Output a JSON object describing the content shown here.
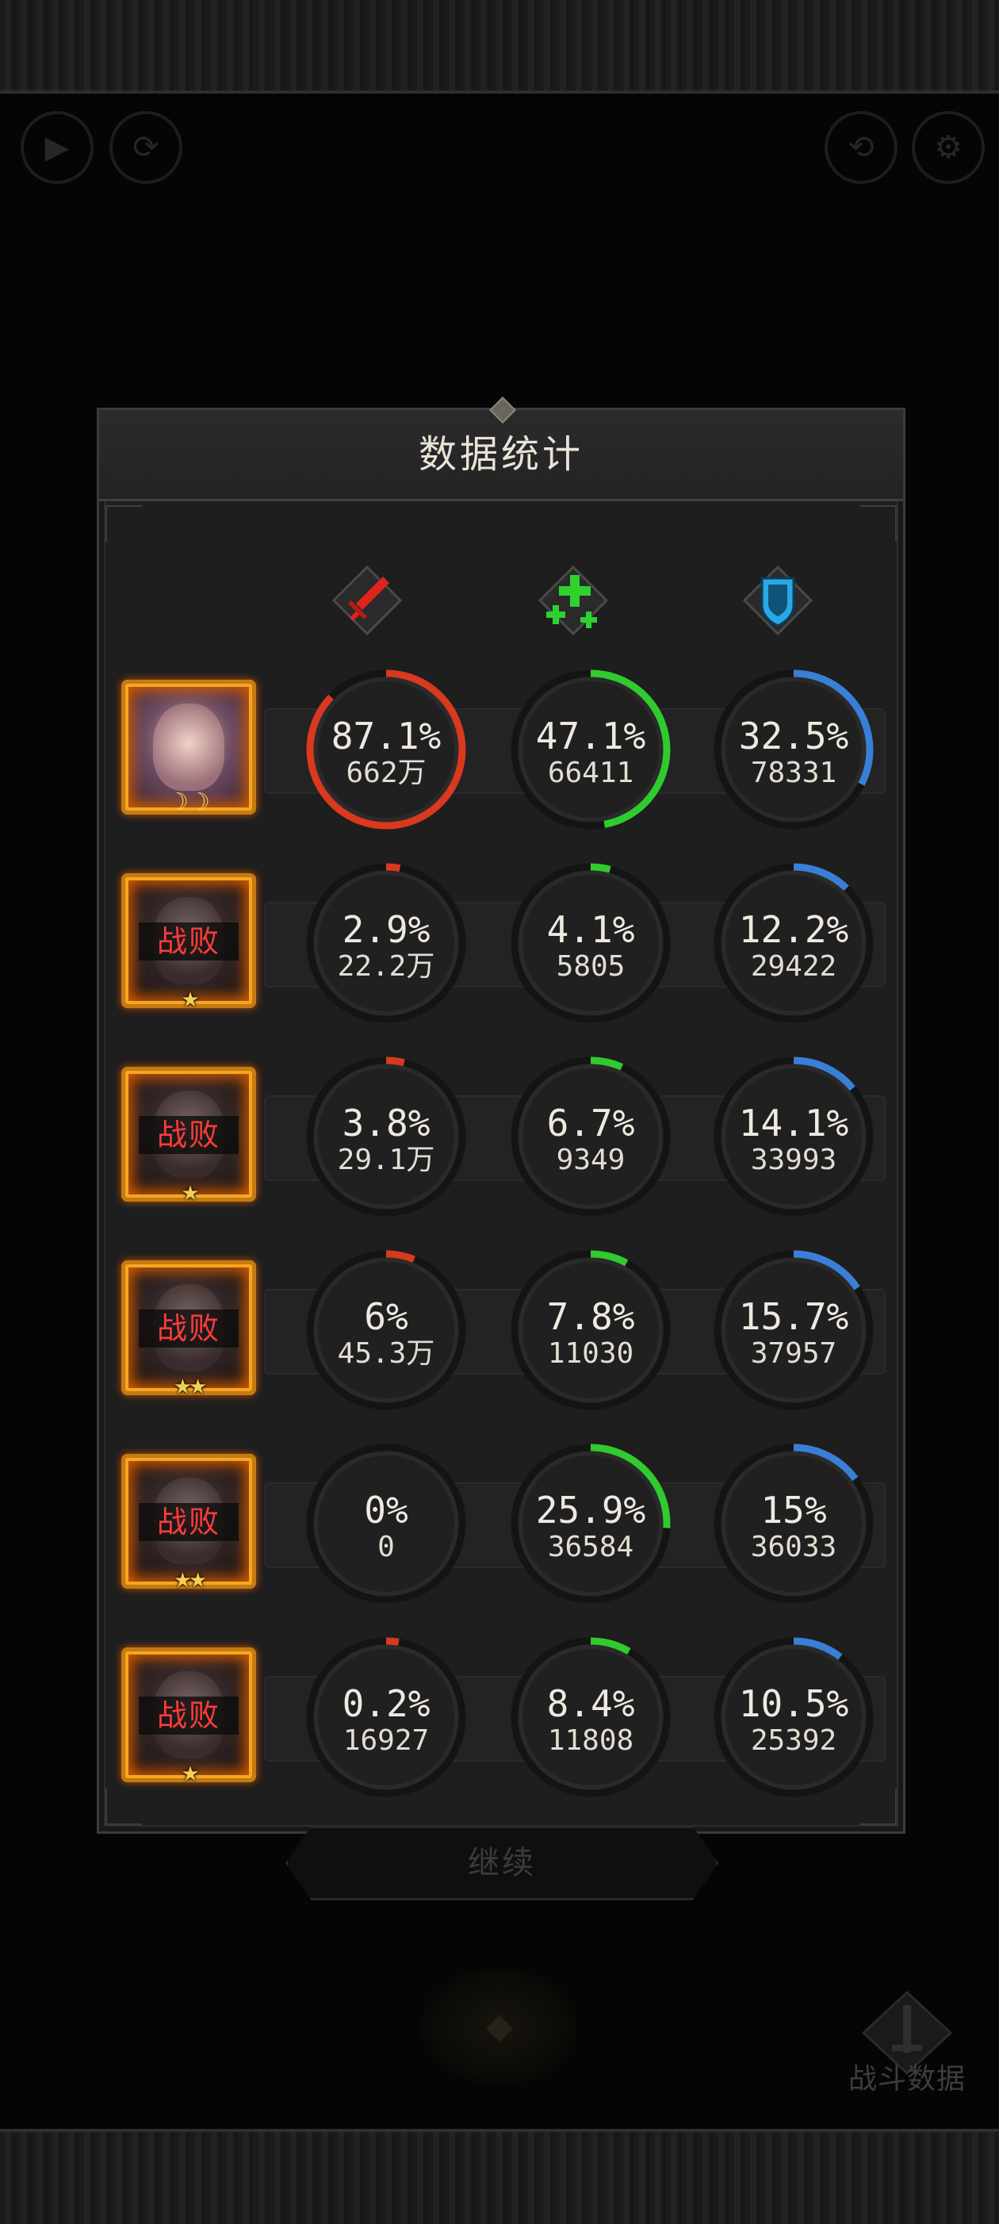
{
  "panel": {
    "title": "数据统计"
  },
  "columns": [
    {
      "icon": "sword-icon",
      "color": "#e0241b"
    },
    {
      "icon": "heal-plus-icon",
      "color": "#2fd12f"
    },
    {
      "icon": "shield-icon",
      "color": "#2aa7e6"
    }
  ],
  "ring_colors": {
    "damage": "#d9391f",
    "heal": "#2fcb2f",
    "tank": "#3a7fd6",
    "track": "#141414"
  },
  "heroes": [
    {
      "status": "",
      "stars": "",
      "rank_icon": "moon-rank-icon",
      "damage": {
        "pct": "87.1%",
        "amount": "662万",
        "fraction": 0.871
      },
      "heal": {
        "pct": "47.1%",
        "amount": "66411",
        "fraction": 0.471
      },
      "tank": {
        "pct": "32.5%",
        "amount": "78331",
        "fraction": 0.325
      }
    },
    {
      "status": "战败",
      "stars": "★",
      "damage": {
        "pct": "2.9%",
        "amount": "22.2万",
        "fraction": 0.029
      },
      "heal": {
        "pct": "4.1%",
        "amount": "5805",
        "fraction": 0.041
      },
      "tank": {
        "pct": "12.2%",
        "amount": "29422",
        "fraction": 0.122
      }
    },
    {
      "status": "战败",
      "stars": "★",
      "damage": {
        "pct": "3.8%",
        "amount": "29.1万",
        "fraction": 0.038
      },
      "heal": {
        "pct": "6.7%",
        "amount": "9349",
        "fraction": 0.067
      },
      "tank": {
        "pct": "14.1%",
        "amount": "33993",
        "fraction": 0.141
      }
    },
    {
      "status": "战败",
      "stars": "★★",
      "damage": {
        "pct": "6%",
        "amount": "45.3万",
        "fraction": 0.06
      },
      "heal": {
        "pct": "7.8%",
        "amount": "11030",
        "fraction": 0.078
      },
      "tank": {
        "pct": "15.7%",
        "amount": "37957",
        "fraction": 0.157
      }
    },
    {
      "status": "战败",
      "stars": "★★",
      "damage": {
        "pct": "0%",
        "amount": "0",
        "fraction": 0
      },
      "heal": {
        "pct": "25.9%",
        "amount": "36584",
        "fraction": 0.259
      },
      "tank": {
        "pct": "15%",
        "amount": "36033",
        "fraction": 0.15
      }
    },
    {
      "status": "战败",
      "stars": "★",
      "damage": {
        "pct": "0.2%",
        "amount": "16927",
        "fraction": 0.002
      },
      "heal": {
        "pct": "8.4%",
        "amount": "11808",
        "fraction": 0.084
      },
      "tank": {
        "pct": "10.5%",
        "amount": "25392",
        "fraction": 0.105
      }
    }
  ],
  "continue_label": "继续",
  "battle_data_label": "战斗数据"
}
